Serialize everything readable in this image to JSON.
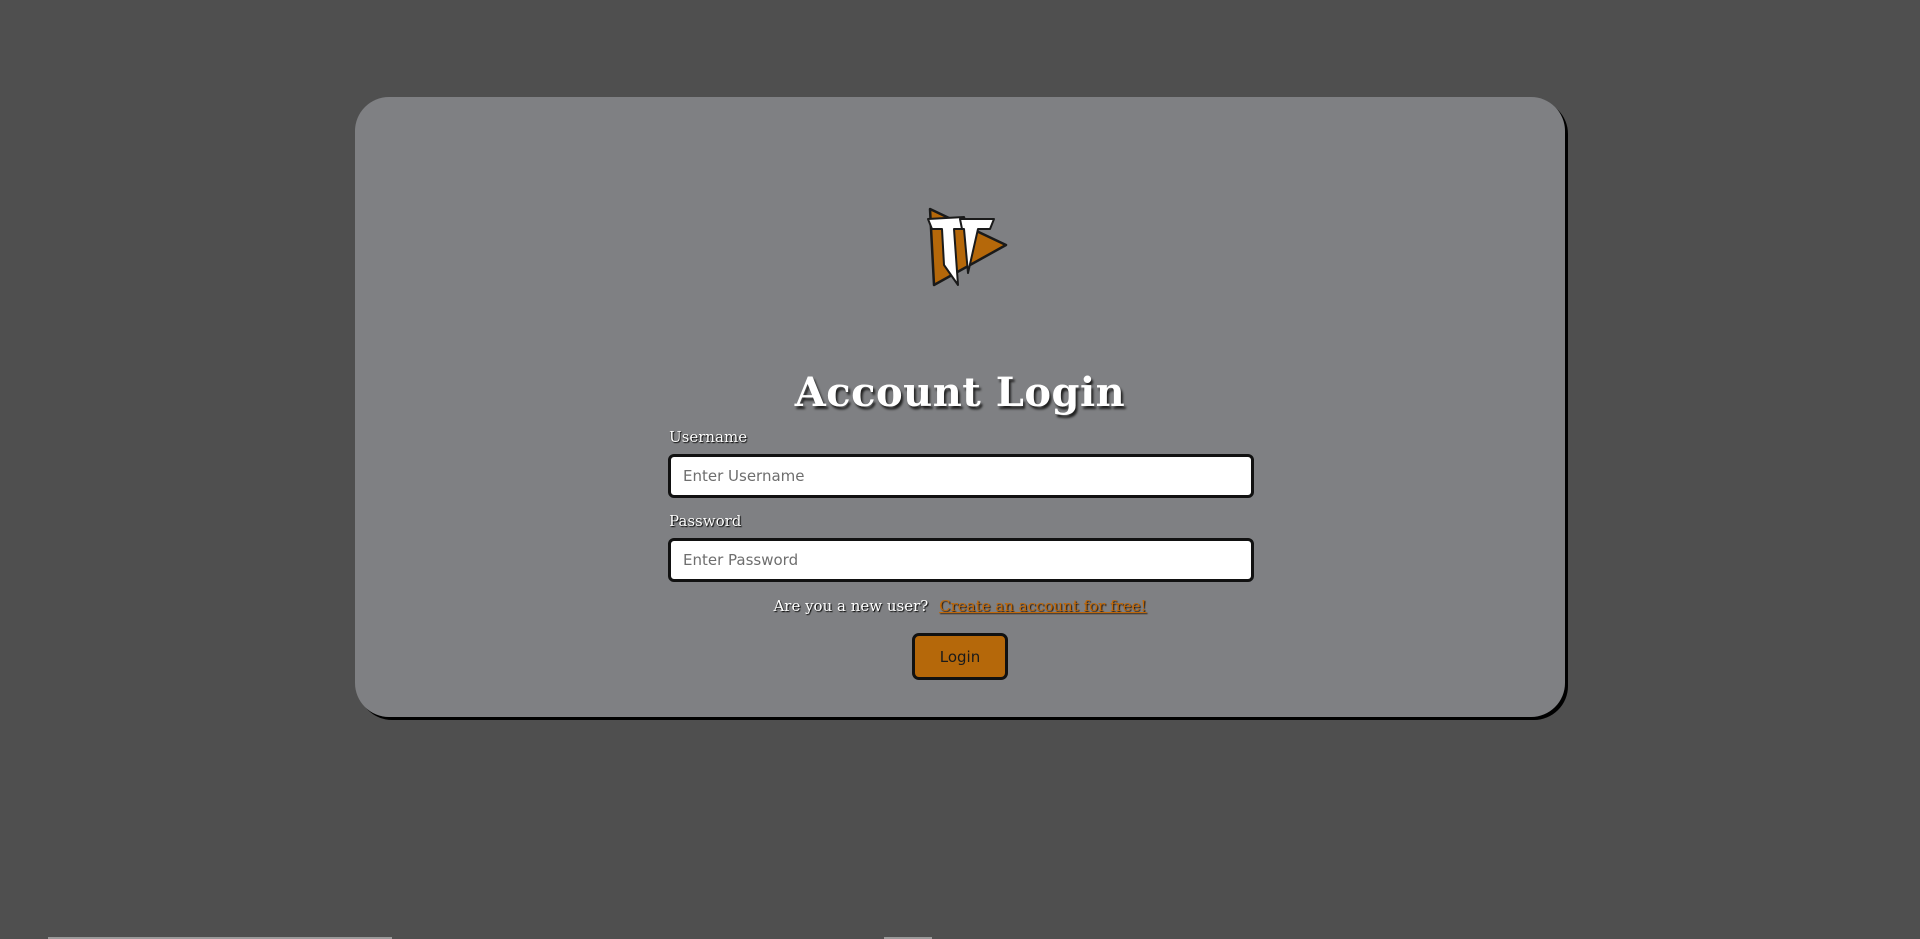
{
  "login": {
    "title": "Account Login",
    "username_label": "Username",
    "username_placeholder": "Enter Username",
    "password_label": "Password",
    "password_placeholder": "Enter Password",
    "signup_question": "Are you a new user?",
    "signup_link": "Create an account for free!",
    "login_button": "Login"
  },
  "logo": {
    "icon": "tt-logo-icon",
    "colors": {
      "primary": "#b5680a",
      "secondary": "#ffffff",
      "outline": "#1a1a1a"
    }
  },
  "theme": {
    "page_background": "#4f4f4f",
    "card_background": "#7f8083",
    "accent": "#b5680a"
  }
}
